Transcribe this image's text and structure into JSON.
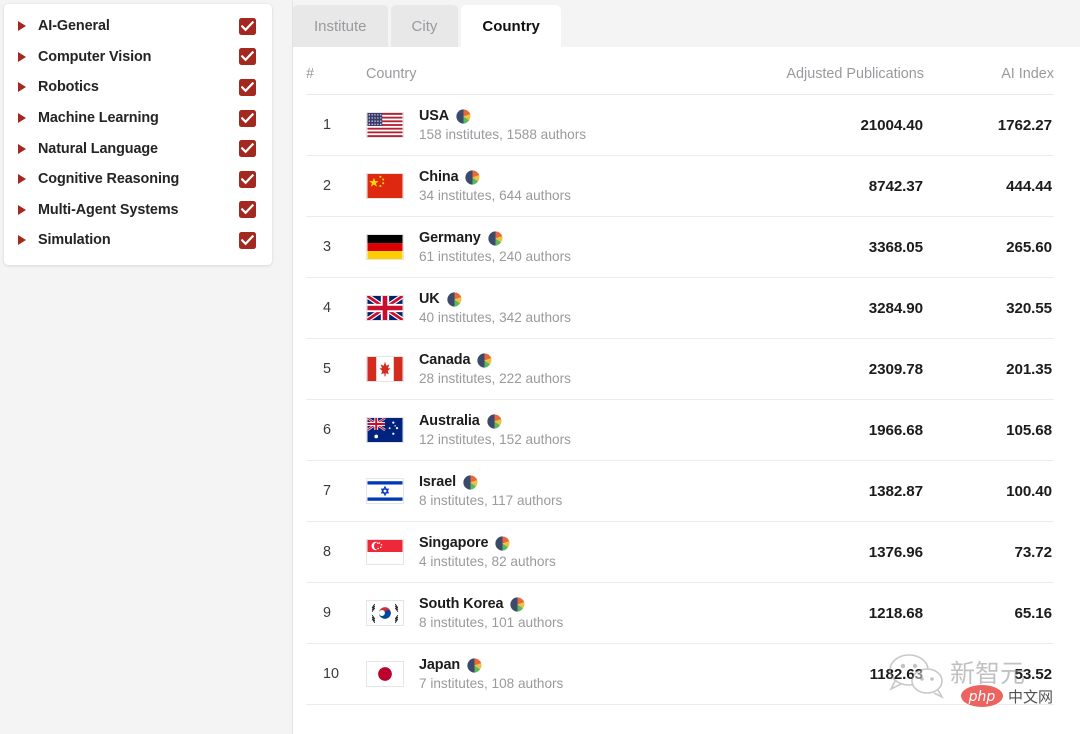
{
  "theme": {
    "accent_red": "#a32820",
    "page_bg": "#f4f4f5",
    "panel_bg": "#ffffff",
    "muted_text": "#9a9a9e"
  },
  "sidebar": {
    "items": [
      {
        "label": "AI-General",
        "expander": "triangle-right-icon",
        "checked": true
      },
      {
        "label": "Computer Vision",
        "expander": "triangle-right-icon",
        "checked": true
      },
      {
        "label": "Robotics",
        "expander": "triangle-right-icon",
        "checked": true
      },
      {
        "label": "Machine Learning",
        "expander": "triangle-right-icon",
        "checked": true
      },
      {
        "label": "Natural Language",
        "expander": "triangle-right-icon",
        "checked": true
      },
      {
        "label": "Cognitive Reasoning",
        "expander": "triangle-right-icon",
        "checked": true
      },
      {
        "label": "Multi-Agent Systems",
        "expander": "triangle-right-icon",
        "checked": true
      },
      {
        "label": "Simulation",
        "expander": "triangle-right-icon",
        "checked": true
      }
    ]
  },
  "tabs": [
    {
      "label": "Institute",
      "active": false
    },
    {
      "label": "City",
      "active": false
    },
    {
      "label": "Country",
      "active": true
    }
  ],
  "table": {
    "headers": {
      "rank": "#",
      "name": "Country",
      "publications": "Adjusted Publications",
      "index": "AI Index"
    },
    "rows": [
      {
        "rank": "1",
        "country": "USA",
        "flag": "flag-usa",
        "meta": "158 institutes, 1588 authors",
        "publications": "21004.40",
        "index": "1762.27"
      },
      {
        "rank": "2",
        "country": "China",
        "flag": "flag-china",
        "meta": "34 institutes, 644 authors",
        "publications": "8742.37",
        "index": "444.44"
      },
      {
        "rank": "3",
        "country": "Germany",
        "flag": "flag-germany",
        "meta": "61 institutes, 240 authors",
        "publications": "3368.05",
        "index": "265.60"
      },
      {
        "rank": "4",
        "country": "UK",
        "flag": "flag-uk",
        "meta": "40 institutes, 342 authors",
        "publications": "3284.90",
        "index": "320.55"
      },
      {
        "rank": "5",
        "country": "Canada",
        "flag": "flag-canada",
        "meta": "28 institutes, 222 authors",
        "publications": "2309.78",
        "index": "201.35"
      },
      {
        "rank": "6",
        "country": "Australia",
        "flag": "flag-australia",
        "meta": "12 institutes, 152 authors",
        "publications": "1966.68",
        "index": "105.68"
      },
      {
        "rank": "7",
        "country": "Israel",
        "flag": "flag-israel",
        "meta": "8 institutes, 117 authors",
        "publications": "1382.87",
        "index": "100.40"
      },
      {
        "rank": "8",
        "country": "Singapore",
        "flag": "flag-singapore",
        "meta": "4 institutes, 82 authors",
        "publications": "1376.96",
        "index": "73.72"
      },
      {
        "rank": "9",
        "country": "South Korea",
        "flag": "flag-south-korea",
        "meta": "8 institutes, 101 authors",
        "publications": "1218.68",
        "index": "65.16"
      },
      {
        "rank": "10",
        "country": "Japan",
        "flag": "flag-japan",
        "meta": "7 institutes, 108 authors",
        "publications": "1182.63",
        "index": "53.52"
      }
    ]
  },
  "watermark": {
    "brand_cn": "新智元",
    "badge_text": "php",
    "badge_suffix": "中文网"
  }
}
